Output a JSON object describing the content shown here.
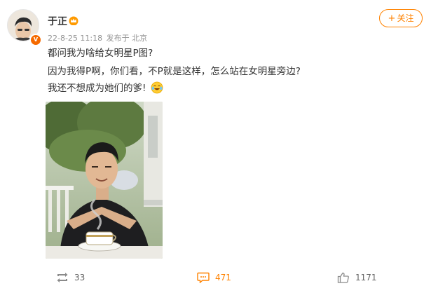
{
  "post": {
    "author": {
      "name": "于正",
      "verified_badge": "V",
      "crown_icon": "crown-icon"
    },
    "meta": {
      "time": "22-8-25 11:18",
      "source": "发布于 北京"
    },
    "follow_button": {
      "label": "关注",
      "icon": "plus-icon",
      "accent": "#ff8200"
    },
    "content": {
      "line1": "都问我为啥给女明星P图?",
      "line2": "因为我得P啊，你们看，不P就是这样，怎么站在女明星旁边?",
      "line3": "我还不想成为她们的爹!",
      "line3_emoji": "laughing-tears-emoji"
    },
    "photo": {
      "icon": "photo-man-with-cup"
    },
    "actions": {
      "repost": {
        "icon": "repost-icon",
        "count": "33"
      },
      "comment": {
        "icon": "comment-icon",
        "count": "471",
        "color": "#ff8200"
      },
      "like": {
        "icon": "thumbs-up-icon",
        "count": "1171"
      }
    }
  }
}
